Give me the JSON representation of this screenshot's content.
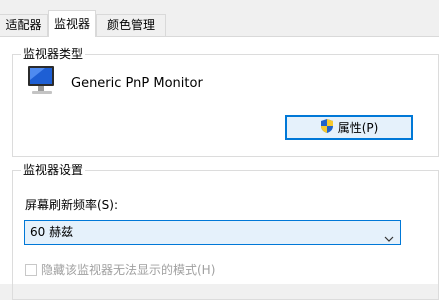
{
  "tabs": [
    {
      "label": "适配器"
    },
    {
      "label": "监视器"
    },
    {
      "label": "颜色管理"
    }
  ],
  "monitor_type": {
    "legend": "监视器类型",
    "monitor_name": "Generic PnP Monitor",
    "properties_button": "属性(P)"
  },
  "monitor_settings": {
    "legend": "监视器设置",
    "refresh_label": "屏幕刷新频率(S):",
    "refresh_value": "60 赫兹",
    "hide_modes_label": "隐藏该监视器无法显示的模式(H)",
    "hide_modes_checked": false
  },
  "colors": {
    "accent": "#0078d7",
    "button_bg": "#e5f1fb"
  }
}
